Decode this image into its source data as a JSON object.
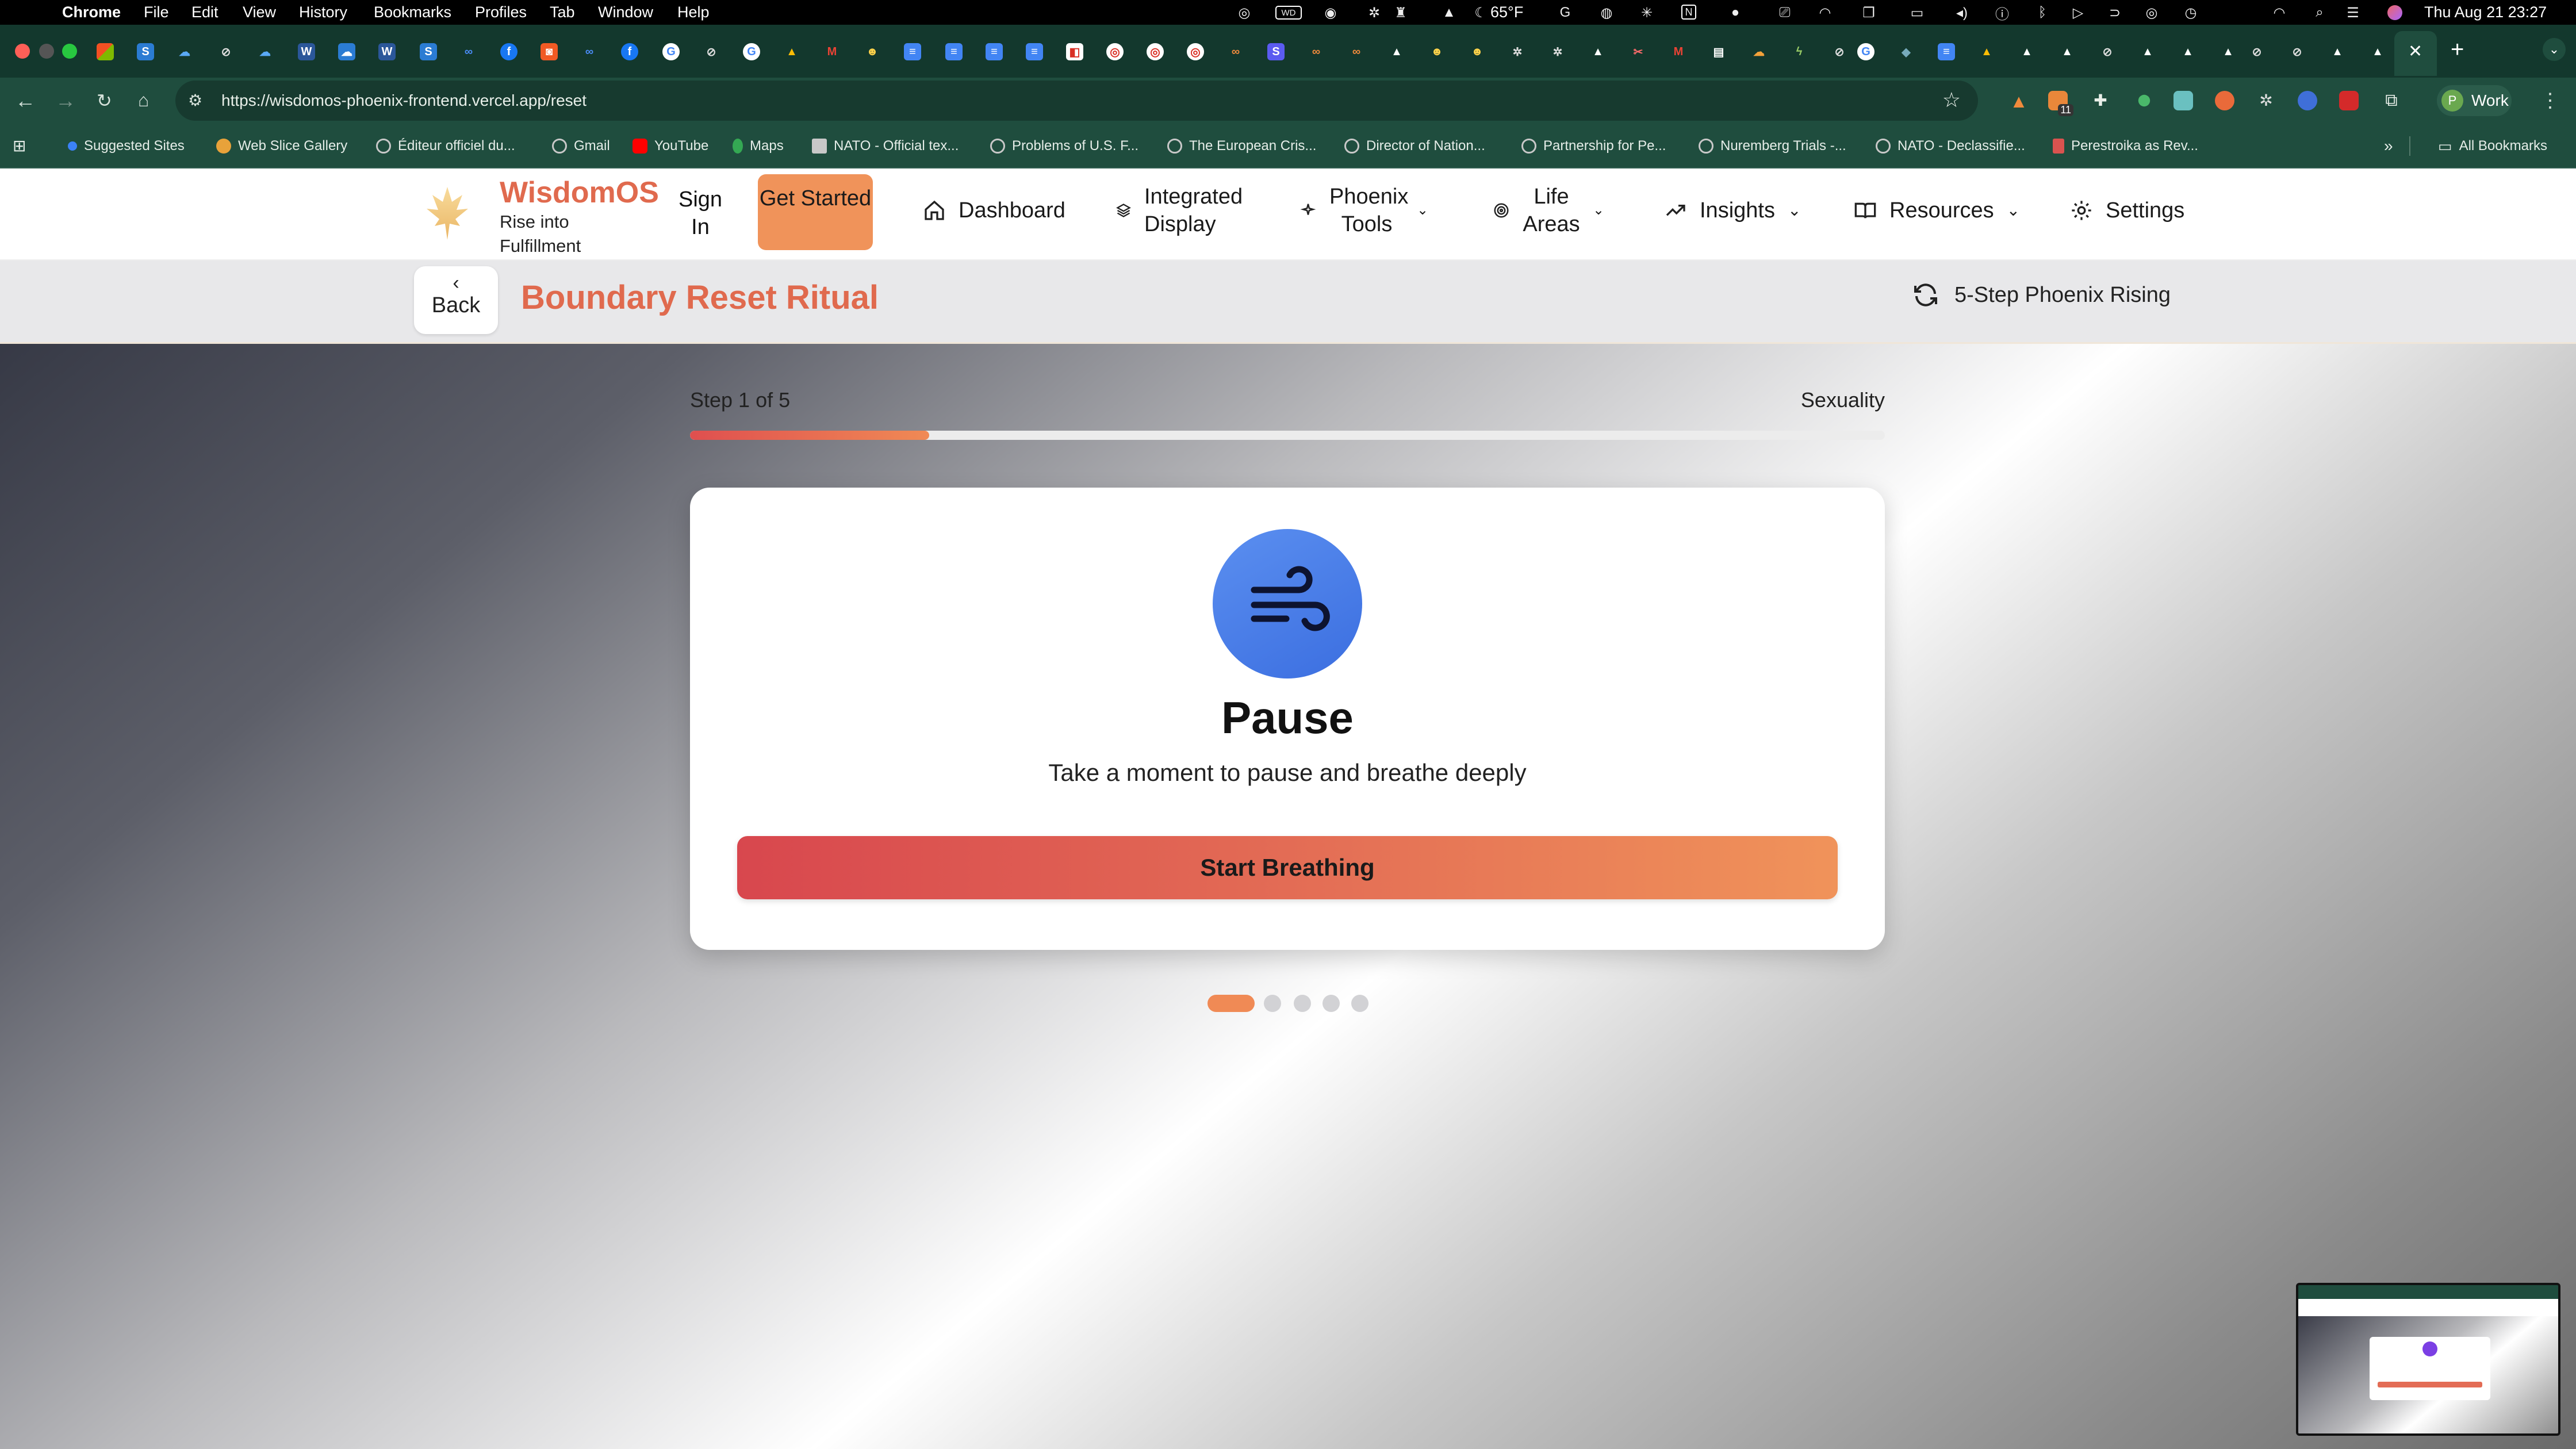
{
  "menubar": {
    "app": "Chrome",
    "items": [
      "File",
      "Edit",
      "View",
      "History",
      "Bookmarks",
      "Profiles",
      "Tab",
      "Window",
      "Help"
    ],
    "weather": "65°F",
    "datetime": "Thu Aug 21  23:27"
  },
  "browser": {
    "url": "https://wisdomos-phoenix-frontend.vercel.app/reset",
    "profile_label": "Work",
    "profile_initial": "P",
    "extension_badge": "11",
    "new_tab": "+",
    "bookmarks": [
      {
        "label": "Suggested Sites",
        "color": "#3b82f6"
      },
      {
        "label": "Web Slice Gallery",
        "color": "#e8a23a"
      },
      {
        "label": "Éditeur officiel du...",
        "color": "#c8c8c8"
      },
      {
        "label": "Gmail",
        "color": "#c8c8c8"
      },
      {
        "label": "YouTube",
        "color": "#ff0000"
      },
      {
        "label": "Maps",
        "color": "#34a853"
      },
      {
        "label": "NATO - Official tex...",
        "color": "#c8c8c8"
      },
      {
        "label": "Problems of U.S. F...",
        "color": "#c8c8c8"
      },
      {
        "label": "The European Cris...",
        "color": "#c8c8c8"
      },
      {
        "label": "Director of Nation...",
        "color": "#c8c8c8"
      },
      {
        "label": "Partnership for Pe...",
        "color": "#c8c8c8"
      },
      {
        "label": "Nuremberg Trials -...",
        "color": "#c8c8c8"
      },
      {
        "label": "NATO - Declassifie...",
        "color": "#c8c8c8"
      },
      {
        "label": "Perestroika as Rev...",
        "color": "#d9534f"
      }
    ],
    "all_bookmarks": "All Bookmarks"
  },
  "app": {
    "brand": "WisdomOS",
    "tagline": "Rise into Fulfillment",
    "sign_in": "Sign In",
    "get_started": "Get Started",
    "nav": {
      "dashboard": "Dashboard",
      "integrated_display": "Integrated Display",
      "phoenix_tools": "Phoenix Tools",
      "life_areas": "Life Areas",
      "insights": "Insights",
      "resources": "Resources",
      "settings": "Settings"
    },
    "back": "Back",
    "page_title": "Boundary Reset Ritual",
    "flow_label": "5-Step Phoenix Rising",
    "step_text": "Step 1 of 5",
    "life_area": "Sexuality",
    "progress_fraction": 0.2,
    "card": {
      "icon": "wind-icon",
      "title": "Pause",
      "subtitle": "Take a moment to pause and breathe deeply",
      "button": "Start Breathing"
    },
    "steps_total": 5,
    "step_current": 1
  },
  "colors": {
    "brand": "#e06a4e",
    "accent_orange": "#f0935a",
    "accent_red": "#d8474e",
    "icon_blue": "#3b6ee0",
    "browser_green": "#1f4d3e"
  }
}
